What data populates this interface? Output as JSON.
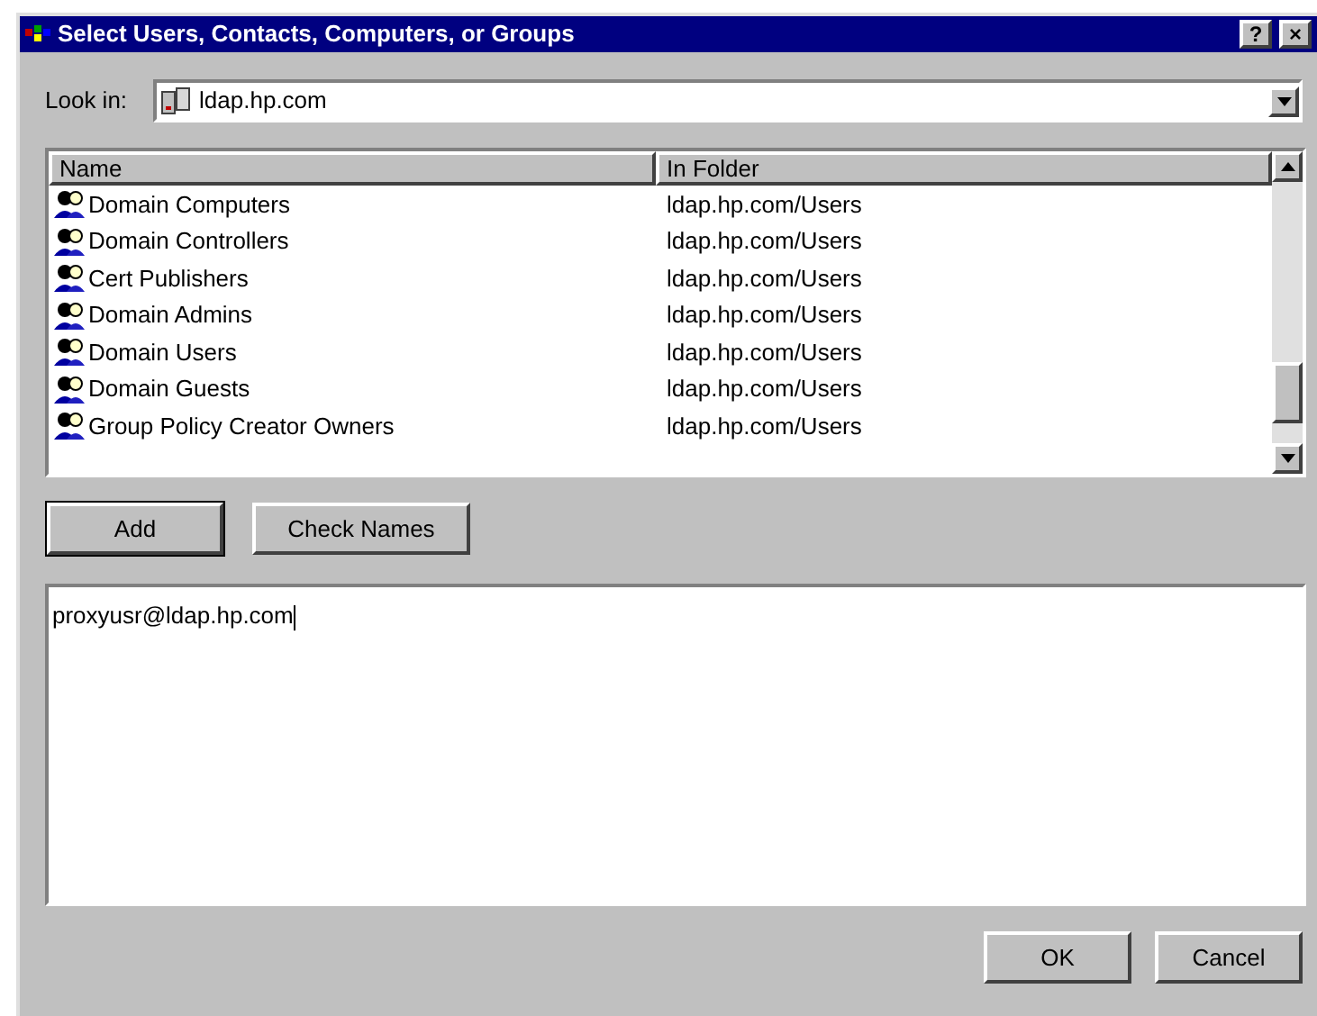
{
  "window": {
    "title": "Select Users, Contacts, Computers, or Groups",
    "buttons": [
      "?",
      "×"
    ]
  },
  "look_in": {
    "label": "Look in:",
    "value": "ldap.hp.com"
  },
  "table": {
    "columns": [
      "Name",
      "In Folder"
    ],
    "rows": [
      {
        "name": "Domain Computers",
        "folder": "ldap.hp.com/Users"
      },
      {
        "name": "Domain Controllers",
        "folder": "ldap.hp.com/Users"
      },
      {
        "name": "Cert Publishers",
        "folder": "ldap.hp.com/Users"
      },
      {
        "name": "Domain Admins",
        "folder": "ldap.hp.com/Users"
      },
      {
        "name": "Domain Users",
        "folder": "ldap.hp.com/Users"
      },
      {
        "name": "Domain Guests",
        "folder": "ldap.hp.com/Users"
      },
      {
        "name": "Group Policy Creator Owners",
        "folder": "ldap.hp.com/Users"
      }
    ]
  },
  "actions": [
    {
      "label": "Add",
      "default": true
    },
    {
      "label": "Check Names",
      "default": false
    }
  ],
  "names_box": {
    "value": "proxyusr@ldap.hp.com"
  },
  "footer_buttons": [
    "OK",
    "Cancel"
  ]
}
